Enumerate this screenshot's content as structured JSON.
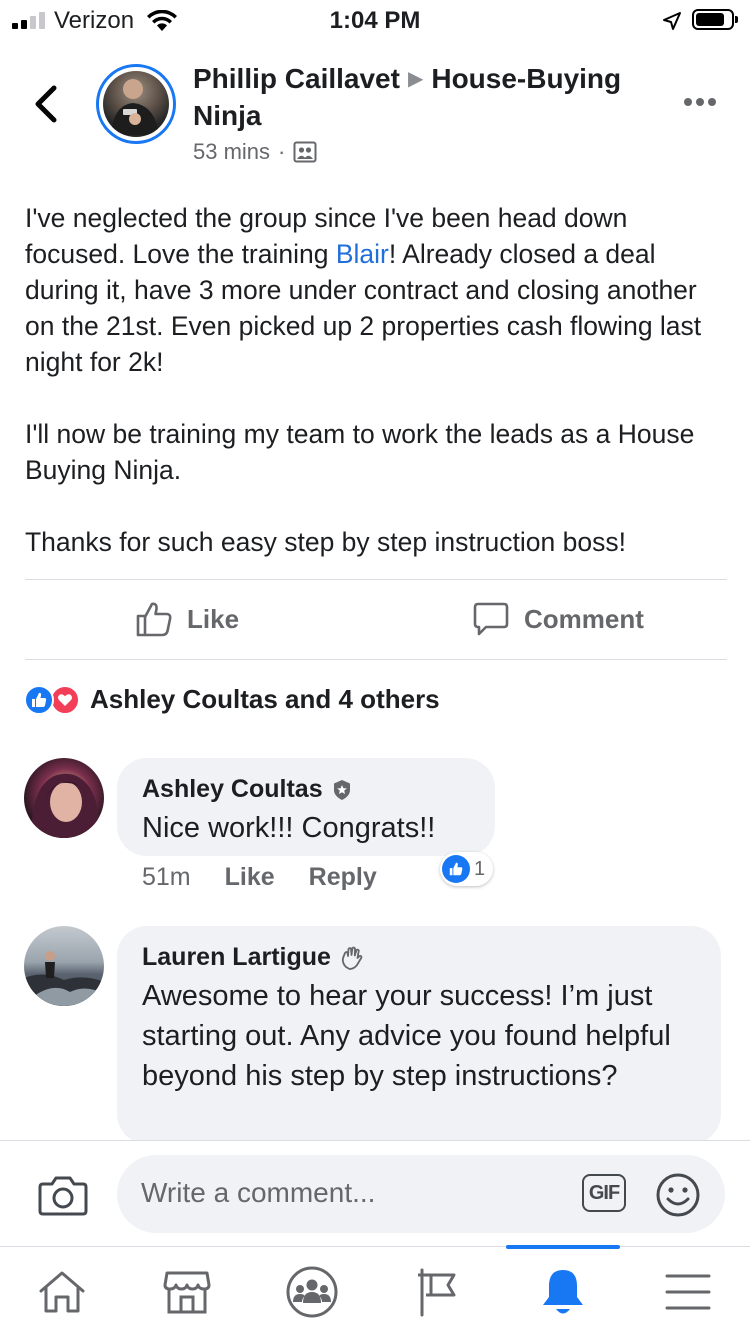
{
  "status_bar": {
    "carrier": "Verizon",
    "time": "1:04 PM"
  },
  "header": {
    "author": "Phillip Caillavet",
    "group": "House-Buying Ninja",
    "timestamp": "53 mins",
    "separator": "·"
  },
  "post": {
    "para1_a": "I've neglected the group since I've been head down focused. Love the training ",
    "mention": "Blair",
    "para1_b": "! Already closed a deal during it, have 3 more under contract and closing another on the 21st. Even picked up 2 properties cash flowing last night for 2k!",
    "para2": "I'll now be training my team to work the leads as a House Buying Ninja.",
    "para3": "Thanks for such easy step by step instruction boss!"
  },
  "actions": {
    "like_label": "Like",
    "comment_label": "Comment"
  },
  "reactions": {
    "summary": "Ashley Coultas and 4 others"
  },
  "comments": [
    {
      "name": "Ashley Coultas",
      "text": "Nice work!!! Congrats!!",
      "time": "51m",
      "like_label": "Like",
      "reply_label": "Reply",
      "reaction_count": "1"
    },
    {
      "name": "Lauren Lartigue",
      "text": "Awesome to hear your success! I’m just starting out. Any advice you found helpful beyond his step by step instructions?"
    }
  ],
  "composer": {
    "placeholder": "Write a comment...",
    "gif_label": "GIF"
  },
  "colors": {
    "accent": "#1877f2",
    "mention": "#216fdb",
    "love": "#f33e58",
    "bubble": "#f0f2f5",
    "secondary_text": "#65676b"
  },
  "icons": [
    "signal-icon",
    "wifi-icon",
    "location-icon",
    "battery-icon",
    "back-chevron-icon",
    "more-dots-icon",
    "group-privacy-icon",
    "like-thumb-icon",
    "comment-bubble-icon",
    "like-reaction-icon",
    "love-reaction-icon",
    "admin-badge-icon",
    "wave-hand-icon",
    "camera-icon",
    "gif-icon",
    "emoji-icon",
    "home-icon",
    "marketplace-icon",
    "groups-icon",
    "pages-flag-icon",
    "notifications-bell-icon",
    "menu-icon"
  ]
}
